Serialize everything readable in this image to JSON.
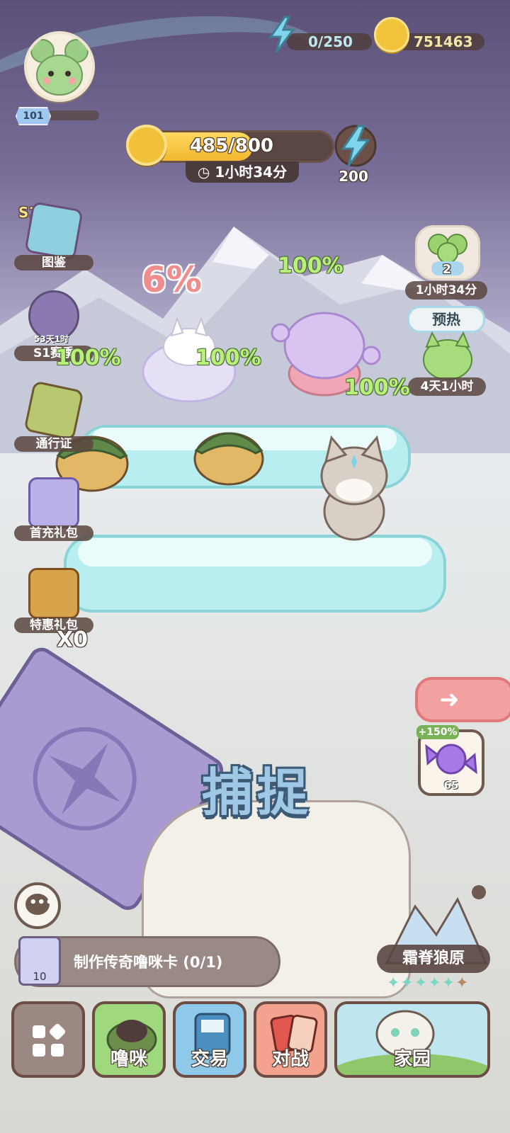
{
  "player": {
    "level": "101"
  },
  "resources": {
    "energy": "0/250",
    "coins": "751463"
  },
  "event": {
    "progress_text": "485/800",
    "progress_fraction": 0.606,
    "timer": "1小时34分",
    "reward_amount": "200"
  },
  "left_menu": [
    {
      "badge": "S1",
      "label": "图鉴",
      "icon": "book-icon"
    },
    {
      "sub": "53天1时",
      "label": "S1赛季",
      "icon": "sword-icon"
    },
    {
      "label": "通行证",
      "icon": "pass-book-icon"
    },
    {
      "label": "首充礼包",
      "icon": "gift-box-icon"
    },
    {
      "label": "特惠礼包",
      "icon": "treasure-chest-icon"
    }
  ],
  "right_menu": {
    "clover_count": "2",
    "clover_timer": "1小时34分",
    "preheat_label": "预热",
    "preheat_timer": "4天1小时"
  },
  "scene": {
    "catch_chance_main": "6%",
    "catch_chances": [
      "100%",
      "100%",
      "100%",
      "100%"
    ],
    "card_count": "X0",
    "capture_label": "捕捉"
  },
  "boost": {
    "percent": "+150%",
    "count": "65"
  },
  "task": {
    "text": "制作传奇噜咪卡 (0/1)",
    "count": "10"
  },
  "region": {
    "name": "霜脊狼原",
    "stars_filled": 5,
    "stars_total": 6
  },
  "nav": [
    {
      "label": "",
      "icon": "menu-grid-icon"
    },
    {
      "label": "噜咪"
    },
    {
      "label": "交易"
    },
    {
      "label": "对战"
    },
    {
      "label": "家园"
    }
  ]
}
